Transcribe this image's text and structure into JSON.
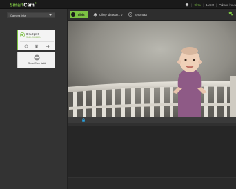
{
  "header": {
    "logo_primary": "Smart",
    "logo_secondary": "Cam",
    "logo_mark": "®",
    "nav": {
      "home_icon": "home-icon",
      "item1": "Skriv",
      "item2": "Merat",
      "item3": "Oikeus kuva"
    }
  },
  "sidebar": {
    "dropdown_value": "Camera lista",
    "camera": {
      "name": "8HLDpn 0",
      "model": "SNH-C6416BN",
      "icons": [
        "camera-icon",
        "delete-icon",
        "settings-icon"
      ]
    },
    "add_label": "SmartCam lisää"
  },
  "toolbar": {
    "live_label": "Tiivis",
    "item_history": "Oikay ideasset : 0",
    "item_playback": "Synantaa",
    "corner_icon": "refresh-icon"
  },
  "colors": {
    "accent": "#7cc243",
    "background": "#2b2b2b"
  }
}
